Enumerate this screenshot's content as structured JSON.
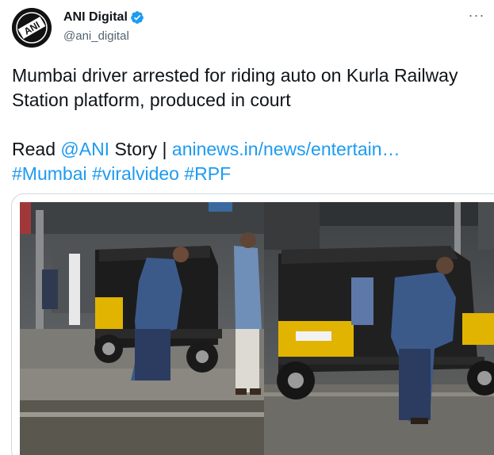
{
  "author": {
    "display_name": "ANI Digital",
    "handle": "@ani_digital",
    "avatar_icon": "ani-logo-icon",
    "verified_icon": "verified-badge-icon",
    "avatar_text": "ANI"
  },
  "more_icon": "more-options-icon",
  "tweet": {
    "line1": "Mumbai driver arrested for riding auto on Kurla Railway",
    "line2": "Station platform, produced in court",
    "read_label": "Read ",
    "mention": "@ANI",
    "story_label": " Story | ",
    "url": "aninews.in/news/entertain…",
    "hashtag1": "#Mumbai",
    "hashtag2": "#viralvideo",
    "hashtag3": "#RPF"
  },
  "media": {
    "photo1_icon": "auto-rickshaw-photo",
    "photo2_icon": "auto-rickshaw-photo"
  },
  "colors": {
    "link": "#1d9bf0",
    "verified": "#1d9bf0",
    "handle": "#536471",
    "auto_yellow": "#e0b400"
  }
}
